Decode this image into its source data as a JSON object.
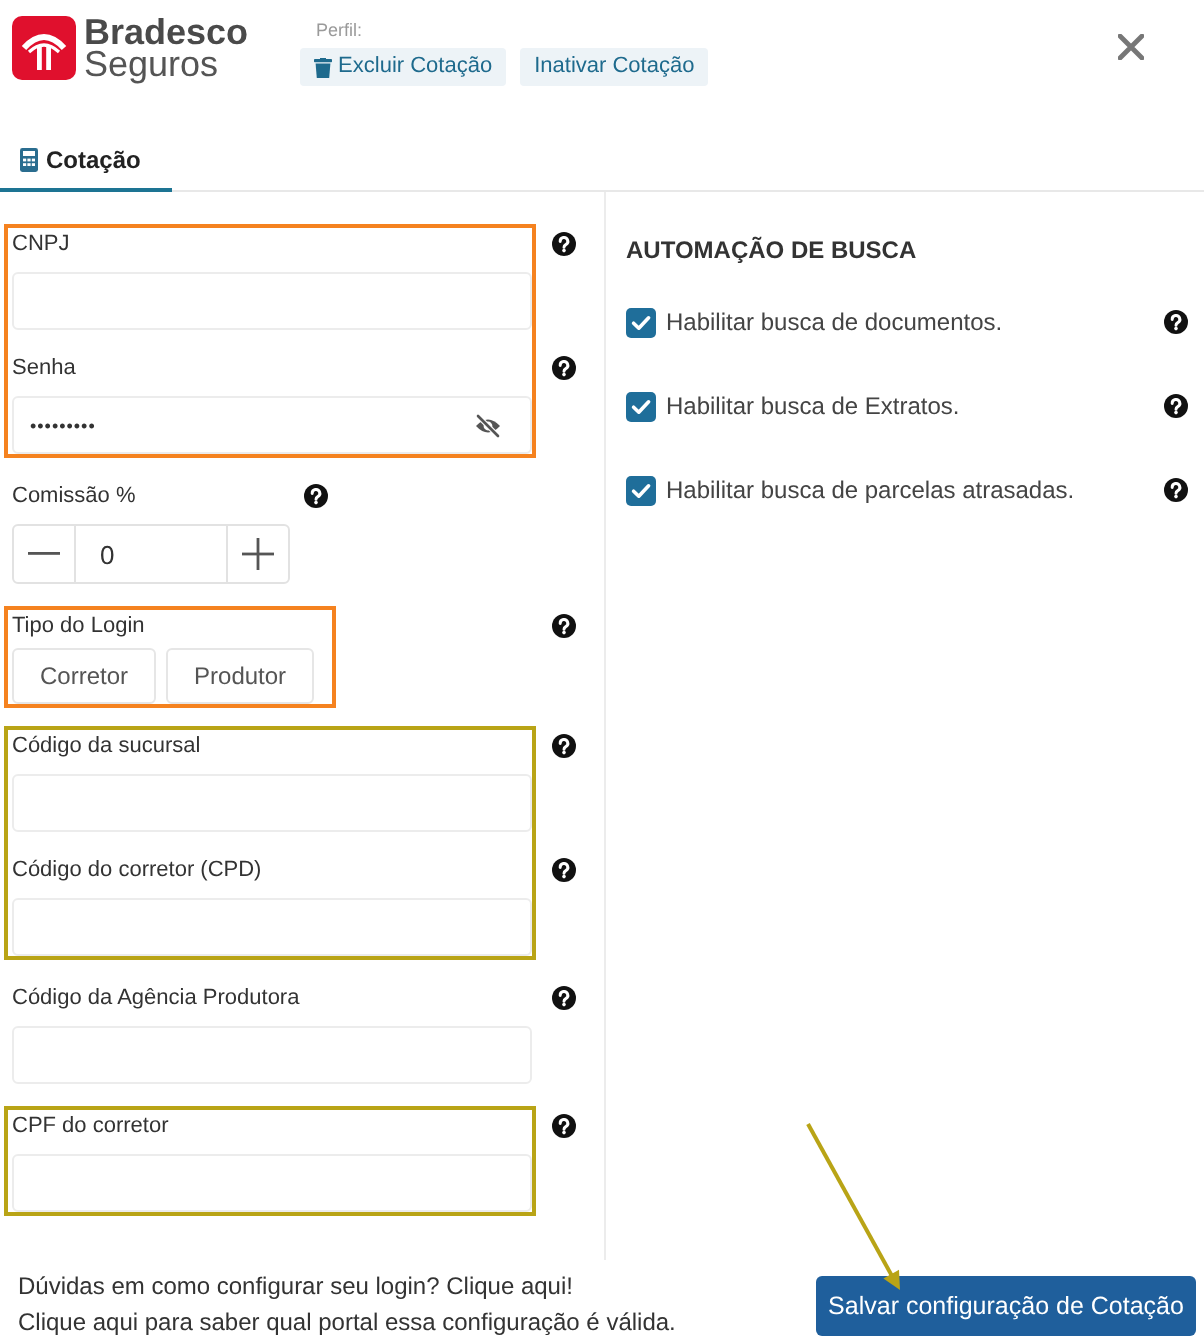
{
  "header": {
    "logo": {
      "name": "Bradesco",
      "tagline": "Seguros"
    },
    "profile_label": "Perfil:",
    "actions": [
      {
        "kind": "delete",
        "label": "Excluir Cotação"
      },
      {
        "kind": "deactivate",
        "label": "Inativar Cotação"
      }
    ]
  },
  "tabs": [
    {
      "label": "Cotação",
      "selected": true
    }
  ],
  "form": {
    "groups": [
      {
        "color": "#f5821f",
        "fields": [
          {
            "kind": "text",
            "label": "CNPJ"
          },
          {
            "kind": "password",
            "label": "Senha",
            "value": "•••••••••"
          }
        ]
      },
      {
        "fields": [
          {
            "kind": "stepper",
            "label": "Comissão %",
            "value": "0"
          }
        ]
      },
      {
        "color": "#f5821f",
        "fields": [
          {
            "kind": "choice",
            "label": "Tipo do Login",
            "options": [
              {
                "label": "Corretor",
                "selected": false
              },
              {
                "label": "Produtor",
                "selected": false
              }
            ]
          }
        ]
      },
      {
        "color": "#b9a416",
        "fields": [
          {
            "kind": "text",
            "label": "Código da sucursal"
          },
          {
            "kind": "text",
            "label": "Código do corretor (CPD)"
          }
        ]
      },
      {
        "fields": [
          {
            "kind": "text",
            "label": "Código da Agência Produtora"
          }
        ]
      },
      {
        "color": "#b9a416",
        "fields": [
          {
            "kind": "text",
            "label": "CPF do corretor"
          }
        ]
      }
    ]
  },
  "automation": {
    "title": "AUTOMAÇÃO DE BUSCA",
    "options": [
      {
        "label": "Habilitar busca de documentos.",
        "checked": true
      },
      {
        "label": "Habilitar busca de Extratos.",
        "checked": true
      },
      {
        "label": "Habilitar busca de parcelas atrasadas.",
        "checked": true
      }
    ]
  },
  "footer": {
    "help_lines": [
      "Dúvidas em como configurar seu login? Clique aqui!",
      "Clique aqui para saber qual portal essa configuração é válida."
    ],
    "save_button": "Salvar configuração de Cotação"
  },
  "annotations": [
    {
      "kind": "arrow",
      "color": "#b9a416"
    }
  ]
}
